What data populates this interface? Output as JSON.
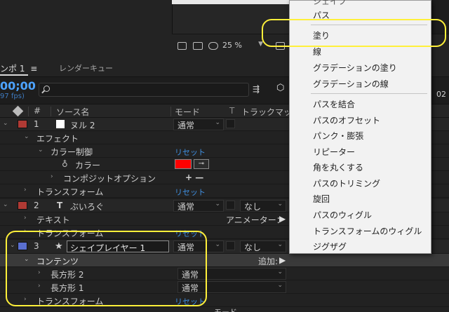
{
  "viewer": {
    "zoom": "25 %"
  },
  "comp_panel": {
    "tab_label": "ンポ 1",
    "tab_menu_icon": "hamburger-icon",
    "render_queue_label": "レンダーキュー",
    "timecode": "00;00",
    "fps": "97 fps)",
    "timeline_marker": "02"
  },
  "columns": {
    "num": "#",
    "source_name": "ソース名",
    "mode": "モード",
    "track_mark_prefix": "T",
    "track_matte": "トラックマット"
  },
  "layers": [
    {
      "num": "1",
      "name": "ヌル 2",
      "mode": "通常",
      "label_color": "#b03a34"
    },
    {
      "num": "2",
      "type_icon": "T",
      "name": "ぶいろぐ",
      "mode": "通常",
      "matte": "なし",
      "label_color": "#b03a34"
    },
    {
      "num": "3",
      "name": "シェイプレイヤー 1",
      "mode": "通常",
      "matte": "なし",
      "label_color": "#5a6fd0"
    }
  ],
  "rows": {
    "effect": "エフェクト",
    "color_control": "カラー制御",
    "reset": "リセット",
    "color": "カラー",
    "color_swatch": "#ff0000",
    "compositing_options": "コンポジットオプション",
    "plus_minus": "+ —",
    "transform": "トランスフォーム",
    "text": "テキスト",
    "animator": "アニメーター：",
    "contents": "コンテンツ",
    "add": "追加:",
    "rect2": "長方形 2",
    "rect1": "長方形 1",
    "normal": "通常",
    "bottom_mode": "モード"
  },
  "menu": {
    "items": [
      "シェイプ",
      "パス",
      "塗り",
      "線",
      "グラデーションの塗り",
      "グラデーションの線",
      "パスを結合",
      "パスのオフセット",
      "パンク・膨張",
      "リピーター",
      "角を丸くする",
      "パスのトリミング",
      "旋回",
      "パスのウィグル",
      "トランスフォームのウィグル",
      "ジグザグ"
    ]
  },
  "colors": {
    "annotation": "#fff03a",
    "link_blue": "#3f8fe0",
    "timecode_blue": "#4da3ff"
  }
}
